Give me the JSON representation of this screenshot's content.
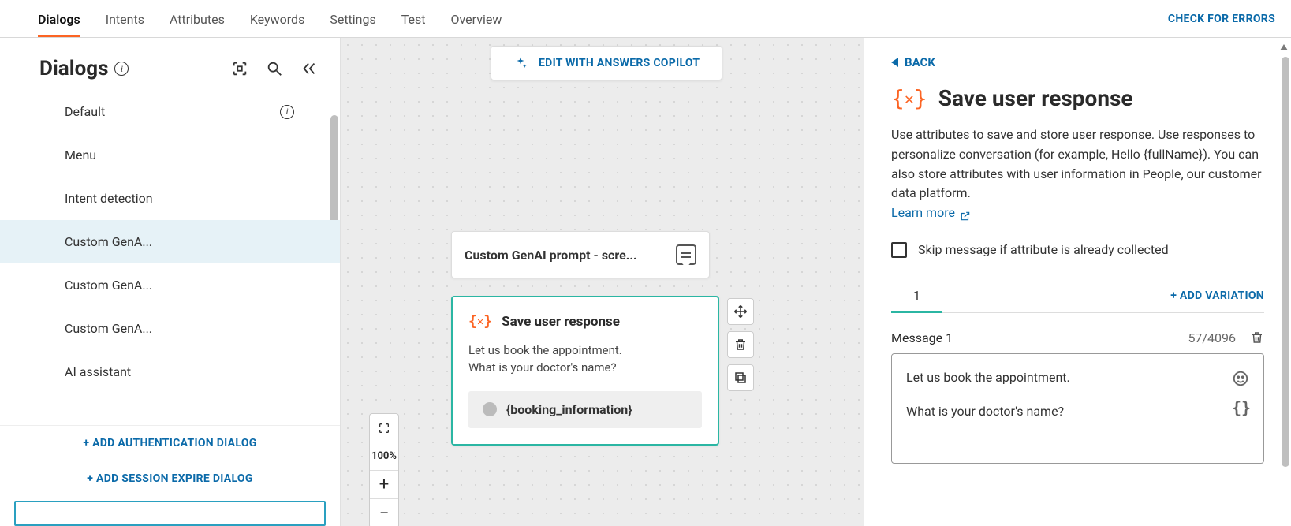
{
  "topbar": {
    "tabs": [
      "Dialogs",
      "Intents",
      "Attributes",
      "Keywords",
      "Settings",
      "Test",
      "Overview"
    ],
    "active_index": 0,
    "check_errors_label": "CHECK FOR ERRORS"
  },
  "sidebar": {
    "title": "Dialogs",
    "items": [
      {
        "label": "Default",
        "has_info": true
      },
      {
        "label": "Menu"
      },
      {
        "label": "Intent detection"
      },
      {
        "label": "Custom GenA...",
        "selected": true
      },
      {
        "label": "Custom GenA..."
      },
      {
        "label": "Custom GenA..."
      },
      {
        "label": "AI assistant"
      }
    ],
    "add_auth_label": "+ ADD AUTHENTICATION DIALOG",
    "add_session_label": "+ ADD SESSION EXPIRE DIALOG"
  },
  "canvas": {
    "copilot_label": "EDIT WITH ANSWERS COPILOT",
    "prompt_card_title": "Custom GenAI prompt - scre...",
    "node": {
      "title": "Save user response",
      "body_line1": "Let us book the appointment.",
      "body_line2": "What is your doctor's name?",
      "attribute": "{booking_information}"
    },
    "zoom_label": "100%"
  },
  "panel": {
    "back_label": "BACK",
    "title": "Save user response",
    "description": "Use attributes to save and store user response. Use responses to personalize conversation (for example, Hello {fullName}). You can also store attributes with user information in People, our customer data platform.",
    "learn_more_label": "Learn more",
    "skip_checkbox_label": "Skip message if attribute is already collected",
    "variation_tab_label": "1",
    "add_variation_label": "+ ADD VARIATION",
    "message_label": "Message 1",
    "char_count": "57/4096",
    "message_line1": "Let us book the appointment.",
    "message_line2": "What is your doctor's name?"
  }
}
